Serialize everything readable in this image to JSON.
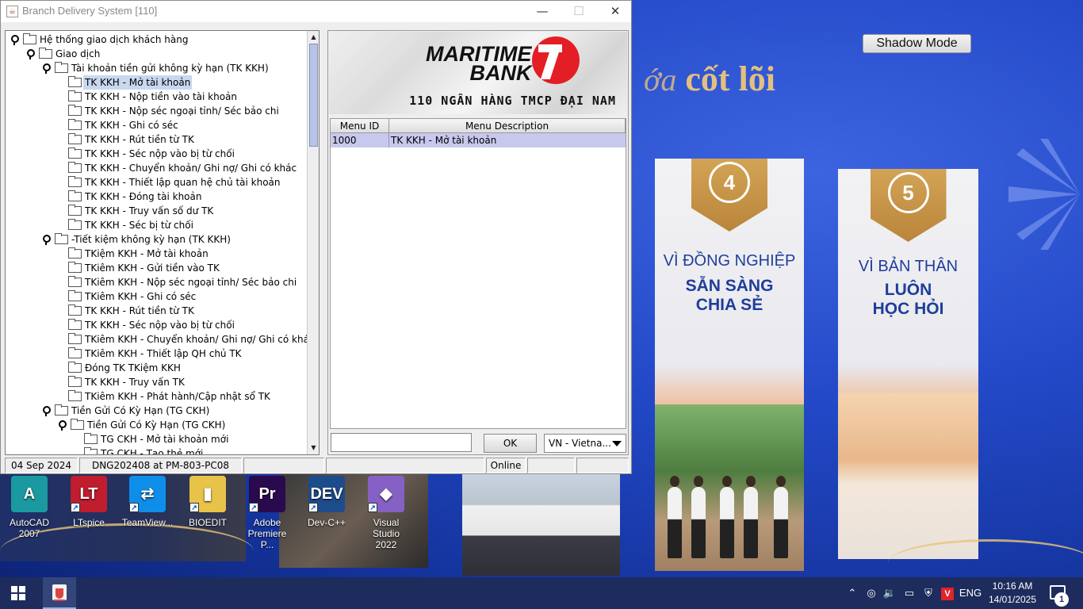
{
  "window": {
    "title": "Branch Delivery System [110]",
    "controls": {
      "minimize": "—",
      "maximize": "☐",
      "close": "✕"
    }
  },
  "tree": {
    "nodes": [
      {
        "level": 0,
        "type": "key",
        "label": "Hệ thống giao dịch khách hàng"
      },
      {
        "level": 1,
        "type": "key",
        "label": "Giao dịch"
      },
      {
        "level": 2,
        "type": "key",
        "label": "Tài khoản tiền gửi không kỳ hạn (TK KKH)"
      },
      {
        "level": 3,
        "type": "leaf",
        "label": "TK KKH - Mở tài khoản",
        "selected": true
      },
      {
        "level": 3,
        "type": "leaf",
        "label": "TK KKH - Nộp tiền vào tài khoản"
      },
      {
        "level": 3,
        "type": "leaf",
        "label": "TK KKH - Nộp séc ngoại tỉnh/ Séc bảo chi"
      },
      {
        "level": 3,
        "type": "leaf",
        "label": "TK KKH - Ghi có séc"
      },
      {
        "level": 3,
        "type": "leaf",
        "label": "TK KKH - Rút tiền từ TK"
      },
      {
        "level": 3,
        "type": "leaf",
        "label": "TK KKH - Séc nộp vào bị từ chối"
      },
      {
        "level": 3,
        "type": "leaf",
        "label": "TK KKH - Chuyển khoản/ Ghi nợ/ Ghi có khác"
      },
      {
        "level": 3,
        "type": "leaf",
        "label": "TK KKH - Thiết lập quan hệ chủ tài khoản"
      },
      {
        "level": 3,
        "type": "leaf",
        "label": "TK KKH - Đóng tài khoản"
      },
      {
        "level": 3,
        "type": "leaf",
        "label": "TK KKH - Truy vấn số dư TK"
      },
      {
        "level": 3,
        "type": "leaf",
        "label": "TK KKH - Séc bị từ chối"
      },
      {
        "level": 2,
        "type": "key",
        "label": "-Tiết kiệm không kỳ hạn (TK KKH)"
      },
      {
        "level": 3,
        "type": "leaf",
        "label": "TKiệm KKH - Mở tài khoản"
      },
      {
        "level": 3,
        "type": "leaf",
        "label": "TKiêm KKH - Gửi tiền vào TK"
      },
      {
        "level": 3,
        "type": "leaf",
        "label": "TKiêm KKH - Nộp séc ngoại tỉnh/ Séc bảo chi"
      },
      {
        "level": 3,
        "type": "leaf",
        "label": "TKiêm KKH - Ghi có séc"
      },
      {
        "level": 3,
        "type": "leaf",
        "label": "TK KKH - Rút tiền từ TK"
      },
      {
        "level": 3,
        "type": "leaf",
        "label": "TK KKH - Séc nộp vào bị từ chối"
      },
      {
        "level": 3,
        "type": "leaf",
        "label": "TKiêm KKH - Chuyển khoản/ Ghi nợ/ Ghi có khác"
      },
      {
        "level": 3,
        "type": "leaf",
        "label": "TKiêm KKH - Thiết lập QH chủ TK"
      },
      {
        "level": 3,
        "type": "leaf",
        "label": "Đóng TK TKiệm KKH"
      },
      {
        "level": 3,
        "type": "leaf",
        "label": "TK KKH - Truy vấn TK"
      },
      {
        "level": 3,
        "type": "leaf",
        "label": "TKiêm KKH - Phát hành/Cập nhật sổ TK"
      },
      {
        "level": 2,
        "type": "key",
        "label": "Tiền Gửi Có Kỳ Hạn (TG CKH)"
      },
      {
        "level": 3,
        "type": "key",
        "label": "Tiền Gửi Có Kỳ Hạn (TG CKH)"
      },
      {
        "level": 4,
        "type": "leaf",
        "label": "TG CKH - Mở tài khoản mới"
      },
      {
        "level": 4,
        "type": "leaf",
        "label": "TG CKH - Tạo thẻ mới"
      }
    ]
  },
  "brand": {
    "logo_line1": "MARITIME",
    "logo_line2": "BANK",
    "bank_name": "110 NGÂN HÀNG TMCP ĐẠI NAM"
  },
  "menu_table": {
    "headers": [
      "Menu ID",
      "Menu Description"
    ],
    "rows": [
      {
        "id": "1000",
        "description": "TK KKH - Mở tài khoản"
      }
    ]
  },
  "command": {
    "value": "",
    "ok_label": "OK",
    "language": "VN - Vietna..."
  },
  "status": {
    "date": "04 Sep 2024",
    "user_station": "DNG202408 at PM-803-PC08",
    "empty1": "",
    "empty2": "",
    "mode": "Online",
    "empty3": "",
    "empty4": ""
  },
  "desktop": {
    "shadow_mode": "Shadow Mode",
    "slogan_prefix": "ớa",
    "slogan": "cốt lõi",
    "banner4": {
      "number": "4",
      "title": "VÌ ĐỒNG NGHIỆP",
      "sub1": "SẴN SÀNG",
      "sub2": "CHIA SẺ"
    },
    "banner5": {
      "number": "5",
      "title": "VÌ BẢN THÂN",
      "sub1": "LUÔN",
      "sub2": "HỌC HỎI"
    },
    "icons": [
      {
        "label1": "AutoCAD",
        "label2": "2007",
        "icon": "autocad-icon",
        "glyph": "A",
        "color": "#1a9aa0"
      },
      {
        "label1": "LTspice",
        "label2": "",
        "icon": "ltspice-icon",
        "glyph": "LT",
        "color": "#c01d2e"
      },
      {
        "label1": "TeamView...",
        "label2": "",
        "icon": "teamviewer-icon",
        "glyph": "⇄",
        "color": "#0e8ee9"
      },
      {
        "label1": "BIOEDIT",
        "label2": "",
        "icon": "bioedit-icon",
        "glyph": "▮",
        "color": "#e8c34a"
      },
      {
        "label1": "Adobe",
        "label2": "Premiere P...",
        "icon": "premiere-icon",
        "glyph": "Pr",
        "color": "#2a0a4e"
      },
      {
        "label1": "Dev-C++",
        "label2": "",
        "icon": "devcpp-icon",
        "glyph": "DEV",
        "color": "#1d4c8c"
      },
      {
        "label1": "Visual Studio",
        "label2": "2022",
        "icon": "visualstudio-icon",
        "glyph": "◆",
        "color": "#8661c5"
      }
    ]
  },
  "taskbar": {
    "lang": "ENG",
    "time": "10:16 AM",
    "date": "14/01/2025",
    "notif_count": "1",
    "tray_icons": [
      "chevron-up-icon",
      "webcam-icon",
      "volume-icon",
      "network-icon",
      "security-icon",
      "antivirus-icon"
    ]
  }
}
